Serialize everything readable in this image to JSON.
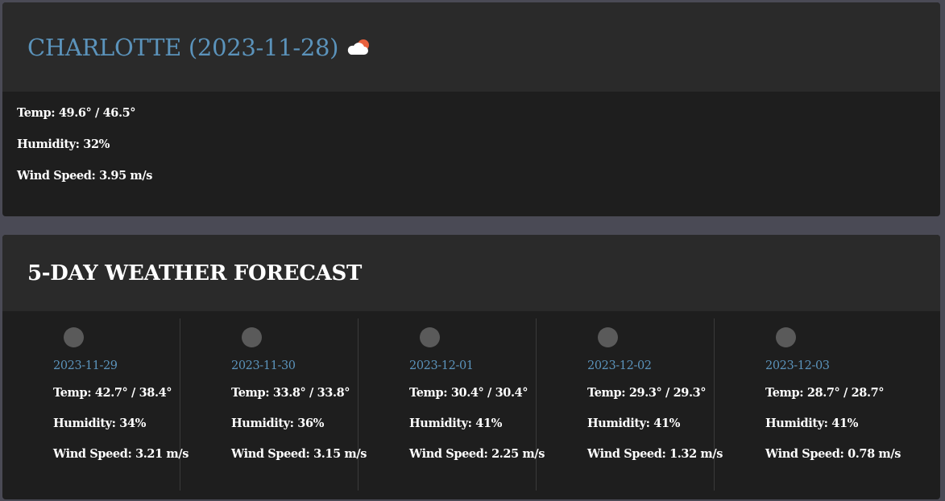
{
  "current": {
    "title": "CHARLOTTE (2023-11-28)",
    "icon": "cloud-sun-icon",
    "temp": "Temp: 49.6° / 46.5°",
    "humidity": "Humidity: 32%",
    "wind": "Wind Speed: 3.95 m/s"
  },
  "forecast": {
    "title": "5-DAY WEATHER FORECAST",
    "days": [
      {
        "date": "2023-11-29",
        "temp": "Temp: 42.7° / 38.4°",
        "humidity": "Humidity: 34%",
        "wind": "Wind Speed: 3.21 m/s"
      },
      {
        "date": "2023-11-30",
        "temp": "Temp: 33.8° / 33.8°",
        "humidity": "Humidity: 36%",
        "wind": "Wind Speed: 3.15 m/s"
      },
      {
        "date": "2023-12-01",
        "temp": "Temp: 30.4° / 30.4°",
        "humidity": "Humidity: 41%",
        "wind": "Wind Speed: 2.25 m/s"
      },
      {
        "date": "2023-12-02",
        "temp": "Temp: 29.3° / 29.3°",
        "humidity": "Humidity: 41%",
        "wind": "Wind Speed: 1.32 m/s"
      },
      {
        "date": "2023-12-03",
        "temp": "Temp: 28.7° / 28.7°",
        "humidity": "Humidity: 41%",
        "wind": "Wind Speed: 0.78 m/s"
      }
    ]
  },
  "colors": {
    "background": "#4a4a55",
    "panel": "#1e1e1e",
    "header": "#2a2a2a",
    "accent": "#5b93bb"
  }
}
